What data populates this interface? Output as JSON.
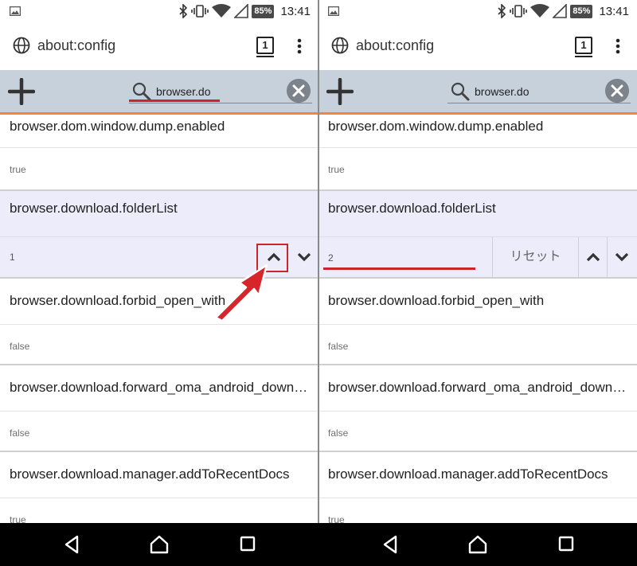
{
  "status_bar": {
    "battery": "85%",
    "time": "13:41"
  },
  "url_bar": {
    "url": "about:config",
    "tab_count": "1"
  },
  "search": {
    "query": "browser.do"
  },
  "prefs": [
    {
      "name": "browser.dom.window.dump.enabled",
      "value": "true"
    },
    {
      "name": "browser.download.folderList",
      "value_left": "1",
      "value_right": "2"
    },
    {
      "name": "browser.download.forbid_open_with",
      "value": "false"
    },
    {
      "name": "browser.download.forward_oma_android_download_manager",
      "value": "false"
    },
    {
      "name": "browser.download.manager.addToRecentDocs",
      "value": "true"
    }
  ],
  "editor": {
    "reset_label": "リセット"
  },
  "colors": {
    "toolbar_bg": "#c6d1dc",
    "accent_orange": "#f2863e",
    "selected_row_bg": "#ececfa",
    "annotation_red": "#c8262b"
  },
  "icons": [
    "photo-icon",
    "bluetooth-icon",
    "vibrate-icon",
    "wifi-icon",
    "signal-icon",
    "globe-icon",
    "overflow-menu-icon",
    "add-icon",
    "search-icon",
    "clear-icon",
    "chevron-up-icon",
    "chevron-down-icon",
    "back-icon",
    "home-icon",
    "recents-icon"
  ]
}
